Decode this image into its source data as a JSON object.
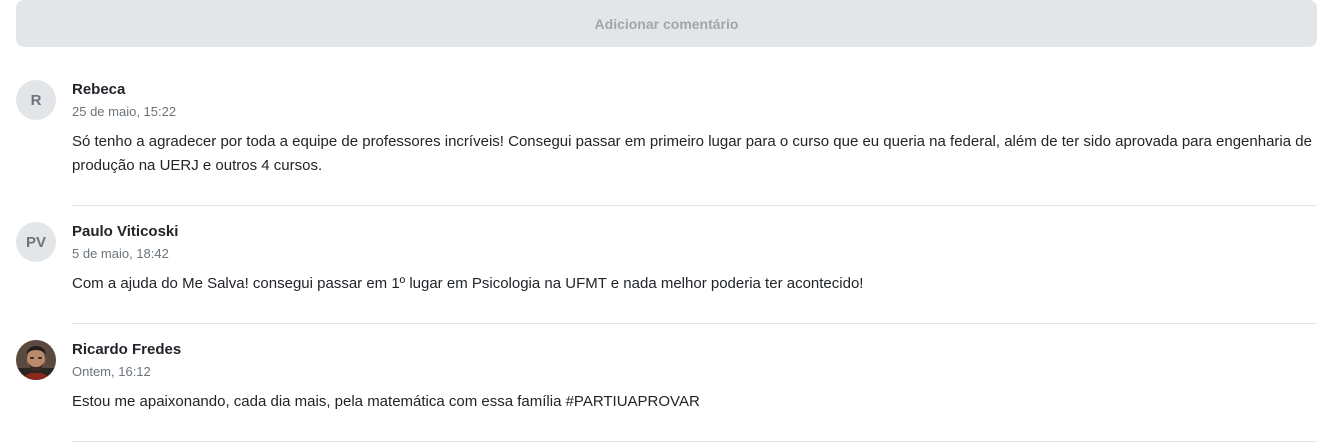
{
  "add_comment_label": "Adicionar comentário",
  "comments": [
    {
      "initials": "R",
      "author": "Rebeca",
      "time": "25 de maio, 15:22",
      "text": "Só tenho a agradecer por toda a equipe de professores incríveis! Consegui passar em primeiro lugar para o curso que eu queria na federal, além de ter sido aprovada para engenharia de produção na UERJ e outros 4 cursos."
    },
    {
      "initials": "PV",
      "author": "Paulo Viticoski",
      "time": "5 de maio, 18:42",
      "text": "Com a ajuda do Me Salva! consegui passar em 1º lugar em Psicologia na UFMT e nada melhor poderia ter acontecido!"
    },
    {
      "author": "Ricardo Fredes",
      "time": "Ontem, 16:12",
      "text": "Estou me apaixonando, cada dia mais, pela matemática com essa família #PARTIUAPROVAR"
    }
  ]
}
